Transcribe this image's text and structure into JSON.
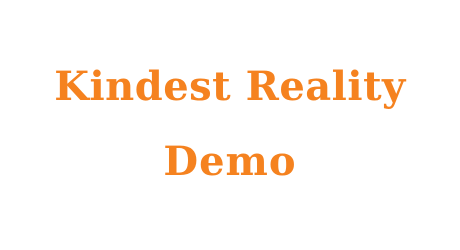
{
  "title": {
    "line1": "Kindest Reality",
    "line2": "Demo"
  },
  "colors": {
    "background": "#ffffff",
    "text": "#f5821f"
  }
}
